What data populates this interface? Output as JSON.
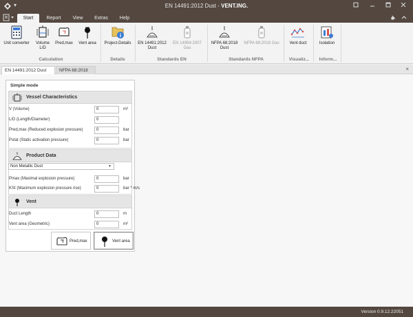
{
  "titlebar": {
    "doc_name": "EN 14491:2012 Dust",
    "separator": " - ",
    "app_name": "VENT.ING.",
    "qa_glyph": "▾"
  },
  "menubar": {
    "tabs": [
      {
        "label": "Start"
      },
      {
        "label": "Report"
      },
      {
        "label": "View"
      },
      {
        "label": "Extras"
      },
      {
        "label": "Help"
      }
    ]
  },
  "ribbon": {
    "buttons": [
      {
        "label_1": "Unit converter",
        "label_2": ""
      },
      {
        "label_1": "Volume",
        "label_2": "L/D"
      },
      {
        "label_1": "Pred,max",
        "label_2": ""
      },
      {
        "label_1": "Vent area",
        "label_2": ""
      },
      {
        "label_1": "Project-Details",
        "label_2": ""
      },
      {
        "label_1": "EN 14491:2012",
        "label_2": "Dust"
      },
      {
        "label_1": "EN 14994:2007",
        "label_2": "Gas"
      },
      {
        "label_1": "NFPA 68:2018",
        "label_2": "Dust"
      },
      {
        "label_1": "NFPA 68:2018 Gas",
        "label_2": ""
      },
      {
        "label_1": "Vent duct",
        "label_2": ""
      },
      {
        "label_1": "Isolation",
        "label_2": ""
      }
    ],
    "groups": [
      {
        "label": "Calculation"
      },
      {
        "label": "Details"
      },
      {
        "label": "Standards EN"
      },
      {
        "label": "Standards NFPA"
      },
      {
        "label": "Visualiz..."
      },
      {
        "label": "Inform..."
      }
    ]
  },
  "doctabs": {
    "tabs": [
      {
        "label": "EN 14491:2012 Dust"
      },
      {
        "label": "NFPA 68:2018 Dust"
      }
    ],
    "close_glyph": "×"
  },
  "panel": {
    "title": "Simple mode",
    "vessel": {
      "title": "Vessel Characteristics",
      "rows": [
        {
          "label": "V (Volume)",
          "value": "0",
          "unit": "m³"
        },
        {
          "label": "L/D (Length/Diameter)",
          "value": "0",
          "unit": ""
        },
        {
          "label": "Pred,max (Reduced explosion pressure)",
          "value": "0",
          "unit": "bar"
        },
        {
          "label": "Pstat (Static activation pressure)",
          "value": "0",
          "unit": "bar"
        }
      ]
    },
    "product": {
      "title": "Product Data",
      "dust_type": "Non Metallic Dust",
      "rows": [
        {
          "label": "Pmax (Maximal explosion pressure)",
          "value": "0",
          "unit": "bar"
        },
        {
          "label": "KSt (Maximum explosion pressure rise)",
          "value": "0",
          "unit": "bar * m/s"
        }
      ]
    },
    "vent": {
      "title": "Vent",
      "rows": [
        {
          "label": "Duct Length",
          "value": "0",
          "unit": "m"
        },
        {
          "label": "Vent area (Geometric)",
          "value": "0",
          "unit": "m²"
        }
      ]
    },
    "buttons": {
      "pred_label": "Pred,max",
      "vent_label": "Vent area"
    }
  },
  "statusbar": {
    "version": "Version 0.9.12.22051"
  },
  "colors": {
    "chrome": "#53473f",
    "accent_blue": "#3a7bd5",
    "accent_red": "#d9534f"
  }
}
